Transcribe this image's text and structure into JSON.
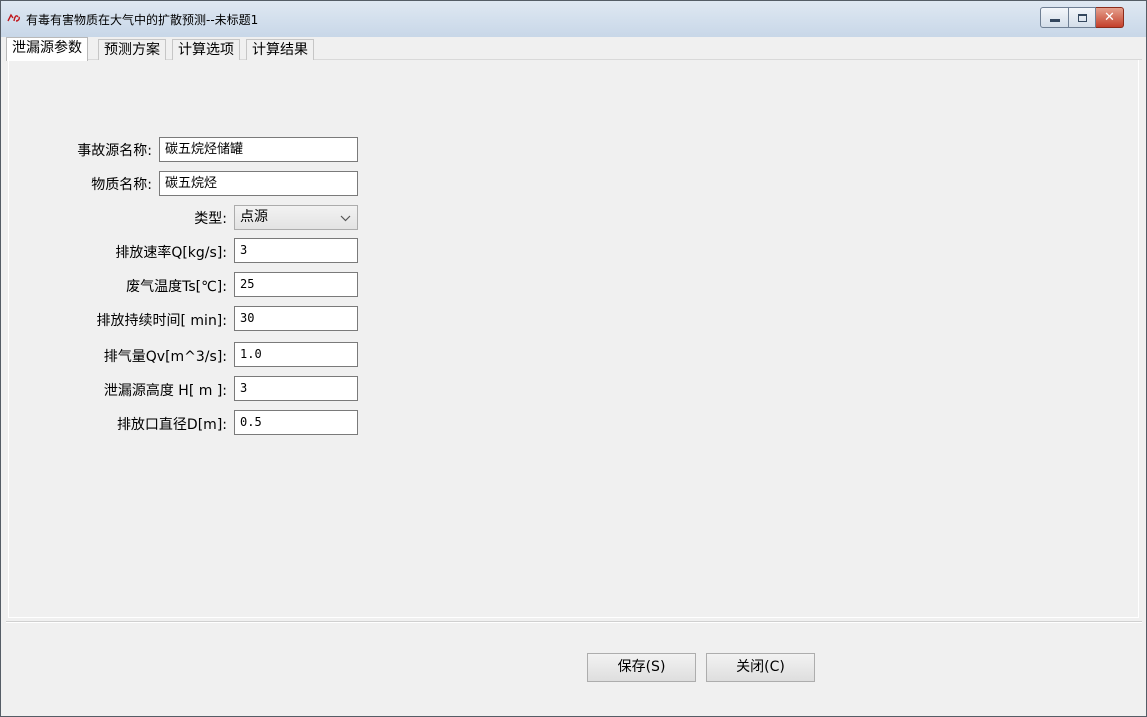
{
  "window": {
    "title": "有毒有害物质在大气中的扩散预测--未标题1",
    "icon": "app-logo-icon",
    "icon_text": "𝓡𝓢"
  },
  "tabs": [
    {
      "label": "泄漏源参数",
      "active": true
    },
    {
      "label": "预测方案",
      "active": false
    },
    {
      "label": "计算选项",
      "active": false
    },
    {
      "label": "计算结果",
      "active": false
    }
  ],
  "form": {
    "source_name": {
      "label": "事故源名称:",
      "value": "碳五烷烃储罐"
    },
    "substance_name": {
      "label": "物质名称:",
      "value": "碳五烷烃"
    },
    "type": {
      "label": "类型:",
      "value": "点源"
    },
    "emission_rate": {
      "label": "排放速率Q[kg/s]:",
      "value": "3"
    },
    "gas_temperature": {
      "label": "废气温度Ts[℃]:",
      "value": "25"
    },
    "duration": {
      "label": "排放持续时间[ min]:",
      "value": "30"
    },
    "gas_volume": {
      "label": "排气量Qv[m^3/s]:",
      "value": "1.0"
    },
    "source_height": {
      "label": "泄漏源高度 H[  m ]:",
      "value": "3"
    },
    "outlet_diameter": {
      "label": "排放口直径D[m]:",
      "value": "0.5"
    }
  },
  "footer": {
    "save_label": "保存(S)",
    "close_label": "关闭(C)"
  }
}
